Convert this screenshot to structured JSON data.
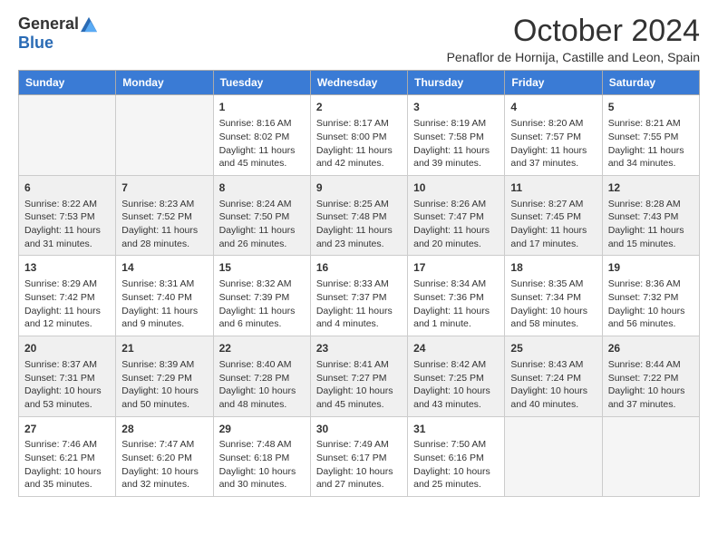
{
  "logo": {
    "general": "General",
    "blue": "Blue"
  },
  "title": "October 2024",
  "subtitle": "Penaflor de Hornija, Castille and Leon, Spain",
  "weekdays": [
    "Sunday",
    "Monday",
    "Tuesday",
    "Wednesday",
    "Thursday",
    "Friday",
    "Saturday"
  ],
  "weeks": [
    [
      {
        "day": "",
        "sunrise": "",
        "sunset": "",
        "daylight": "",
        "empty": true
      },
      {
        "day": "",
        "sunrise": "",
        "sunset": "",
        "daylight": "",
        "empty": true
      },
      {
        "day": "1",
        "sunrise": "Sunrise: 8:16 AM",
        "sunset": "Sunset: 8:02 PM",
        "daylight": "Daylight: 11 hours and 45 minutes."
      },
      {
        "day": "2",
        "sunrise": "Sunrise: 8:17 AM",
        "sunset": "Sunset: 8:00 PM",
        "daylight": "Daylight: 11 hours and 42 minutes."
      },
      {
        "day": "3",
        "sunrise": "Sunrise: 8:19 AM",
        "sunset": "Sunset: 7:58 PM",
        "daylight": "Daylight: 11 hours and 39 minutes."
      },
      {
        "day": "4",
        "sunrise": "Sunrise: 8:20 AM",
        "sunset": "Sunset: 7:57 PM",
        "daylight": "Daylight: 11 hours and 37 minutes."
      },
      {
        "day": "5",
        "sunrise": "Sunrise: 8:21 AM",
        "sunset": "Sunset: 7:55 PM",
        "daylight": "Daylight: 11 hours and 34 minutes."
      }
    ],
    [
      {
        "day": "6",
        "sunrise": "Sunrise: 8:22 AM",
        "sunset": "Sunset: 7:53 PM",
        "daylight": "Daylight: 11 hours and 31 minutes."
      },
      {
        "day": "7",
        "sunrise": "Sunrise: 8:23 AM",
        "sunset": "Sunset: 7:52 PM",
        "daylight": "Daylight: 11 hours and 28 minutes."
      },
      {
        "day": "8",
        "sunrise": "Sunrise: 8:24 AM",
        "sunset": "Sunset: 7:50 PM",
        "daylight": "Daylight: 11 hours and 26 minutes."
      },
      {
        "day": "9",
        "sunrise": "Sunrise: 8:25 AM",
        "sunset": "Sunset: 7:48 PM",
        "daylight": "Daylight: 11 hours and 23 minutes."
      },
      {
        "day": "10",
        "sunrise": "Sunrise: 8:26 AM",
        "sunset": "Sunset: 7:47 PM",
        "daylight": "Daylight: 11 hours and 20 minutes."
      },
      {
        "day": "11",
        "sunrise": "Sunrise: 8:27 AM",
        "sunset": "Sunset: 7:45 PM",
        "daylight": "Daylight: 11 hours and 17 minutes."
      },
      {
        "day": "12",
        "sunrise": "Sunrise: 8:28 AM",
        "sunset": "Sunset: 7:43 PM",
        "daylight": "Daylight: 11 hours and 15 minutes."
      }
    ],
    [
      {
        "day": "13",
        "sunrise": "Sunrise: 8:29 AM",
        "sunset": "Sunset: 7:42 PM",
        "daylight": "Daylight: 11 hours and 12 minutes."
      },
      {
        "day": "14",
        "sunrise": "Sunrise: 8:31 AM",
        "sunset": "Sunset: 7:40 PM",
        "daylight": "Daylight: 11 hours and 9 minutes."
      },
      {
        "day": "15",
        "sunrise": "Sunrise: 8:32 AM",
        "sunset": "Sunset: 7:39 PM",
        "daylight": "Daylight: 11 hours and 6 minutes."
      },
      {
        "day": "16",
        "sunrise": "Sunrise: 8:33 AM",
        "sunset": "Sunset: 7:37 PM",
        "daylight": "Daylight: 11 hours and 4 minutes."
      },
      {
        "day": "17",
        "sunrise": "Sunrise: 8:34 AM",
        "sunset": "Sunset: 7:36 PM",
        "daylight": "Daylight: 11 hours and 1 minute."
      },
      {
        "day": "18",
        "sunrise": "Sunrise: 8:35 AM",
        "sunset": "Sunset: 7:34 PM",
        "daylight": "Daylight: 10 hours and 58 minutes."
      },
      {
        "day": "19",
        "sunrise": "Sunrise: 8:36 AM",
        "sunset": "Sunset: 7:32 PM",
        "daylight": "Daylight: 10 hours and 56 minutes."
      }
    ],
    [
      {
        "day": "20",
        "sunrise": "Sunrise: 8:37 AM",
        "sunset": "Sunset: 7:31 PM",
        "daylight": "Daylight: 10 hours and 53 minutes."
      },
      {
        "day": "21",
        "sunrise": "Sunrise: 8:39 AM",
        "sunset": "Sunset: 7:29 PM",
        "daylight": "Daylight: 10 hours and 50 minutes."
      },
      {
        "day": "22",
        "sunrise": "Sunrise: 8:40 AM",
        "sunset": "Sunset: 7:28 PM",
        "daylight": "Daylight: 10 hours and 48 minutes."
      },
      {
        "day": "23",
        "sunrise": "Sunrise: 8:41 AM",
        "sunset": "Sunset: 7:27 PM",
        "daylight": "Daylight: 10 hours and 45 minutes."
      },
      {
        "day": "24",
        "sunrise": "Sunrise: 8:42 AM",
        "sunset": "Sunset: 7:25 PM",
        "daylight": "Daylight: 10 hours and 43 minutes."
      },
      {
        "day": "25",
        "sunrise": "Sunrise: 8:43 AM",
        "sunset": "Sunset: 7:24 PM",
        "daylight": "Daylight: 10 hours and 40 minutes."
      },
      {
        "day": "26",
        "sunrise": "Sunrise: 8:44 AM",
        "sunset": "Sunset: 7:22 PM",
        "daylight": "Daylight: 10 hours and 37 minutes."
      }
    ],
    [
      {
        "day": "27",
        "sunrise": "Sunrise: 7:46 AM",
        "sunset": "Sunset: 6:21 PM",
        "daylight": "Daylight: 10 hours and 35 minutes."
      },
      {
        "day": "28",
        "sunrise": "Sunrise: 7:47 AM",
        "sunset": "Sunset: 6:20 PM",
        "daylight": "Daylight: 10 hours and 32 minutes."
      },
      {
        "day": "29",
        "sunrise": "Sunrise: 7:48 AM",
        "sunset": "Sunset: 6:18 PM",
        "daylight": "Daylight: 10 hours and 30 minutes."
      },
      {
        "day": "30",
        "sunrise": "Sunrise: 7:49 AM",
        "sunset": "Sunset: 6:17 PM",
        "daylight": "Daylight: 10 hours and 27 minutes."
      },
      {
        "day": "31",
        "sunrise": "Sunrise: 7:50 AM",
        "sunset": "Sunset: 6:16 PM",
        "daylight": "Daylight: 10 hours and 25 minutes."
      },
      {
        "day": "",
        "sunrise": "",
        "sunset": "",
        "daylight": "",
        "empty": true
      },
      {
        "day": "",
        "sunrise": "",
        "sunset": "",
        "daylight": "",
        "empty": true
      }
    ]
  ]
}
